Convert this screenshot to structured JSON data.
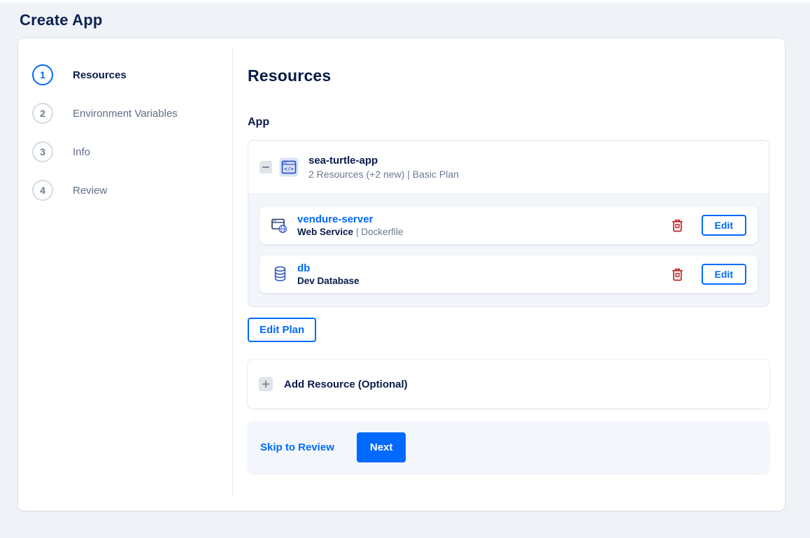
{
  "page": {
    "title": "Create App"
  },
  "colors": {
    "accent_blue": "#0069ff",
    "navy_text": "#081b4a",
    "muted_text": "#6b7a90",
    "danger_red": "#c32222",
    "page_bg": "#eff2f7",
    "group_body_bg": "#f2f5f9",
    "footer_bar_bg": "#f3f7fc"
  },
  "icons": {
    "collapse": "minus-square",
    "app": "app-window-code",
    "web_service": "browser-window-globe",
    "database": "database-cylinder",
    "delete": "trash-can-x",
    "add": "plus-square"
  },
  "steps": [
    {
      "number": "1",
      "label": "Resources"
    },
    {
      "number": "2",
      "label": "Environment Variables"
    },
    {
      "number": "3",
      "label": "Info"
    },
    {
      "number": "4",
      "label": "Review"
    }
  ],
  "content": {
    "heading": "Resources",
    "section_label": "App",
    "app_group": {
      "name": "sea-turtle-app",
      "summary": "2 Resources (+2 new) | Basic Plan",
      "edit_label": "Edit",
      "resources": [
        {
          "name": "vendure-server",
          "type": "Web Service",
          "detail": "| Dockerfile"
        },
        {
          "name": "db",
          "type": "Dev Database",
          "detail": ""
        }
      ]
    },
    "edit_plan_label": "Edit Plan",
    "add_resource_label": "Add Resource (Optional)",
    "footer": {
      "skip_label": "Skip to Review",
      "next_label": "Next"
    }
  }
}
